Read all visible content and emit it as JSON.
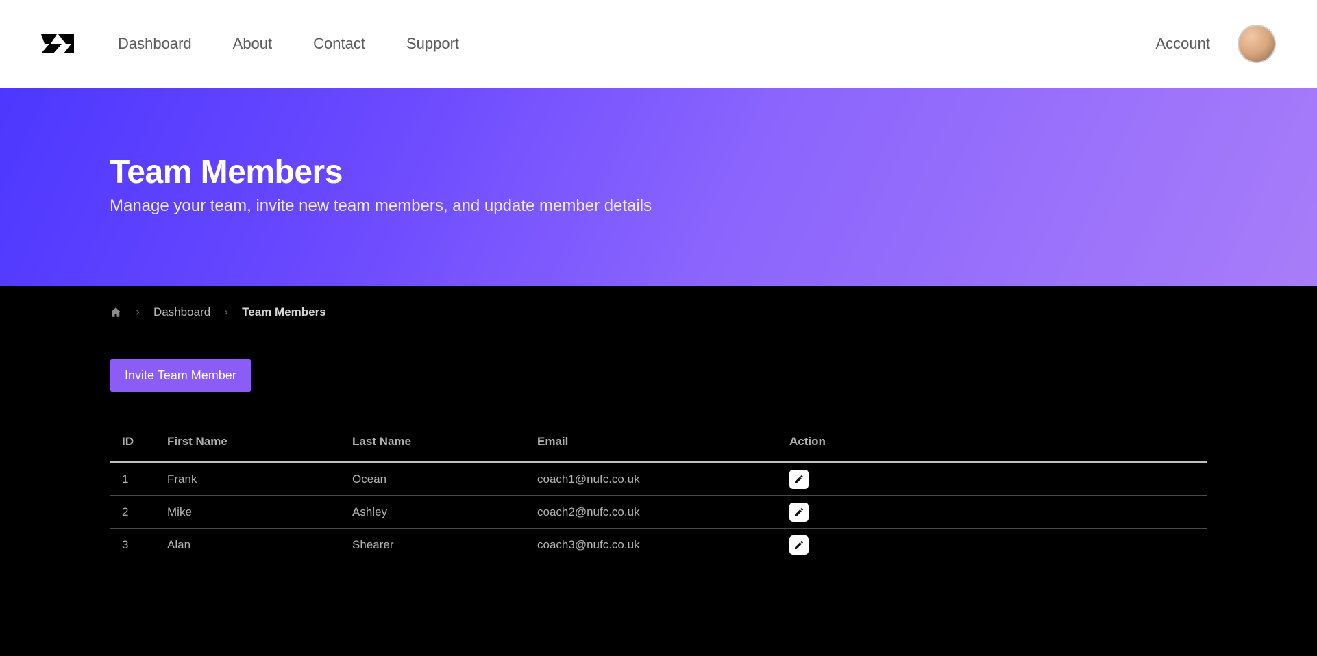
{
  "nav": {
    "links": [
      "Dashboard",
      "About",
      "Contact",
      "Support"
    ],
    "account_label": "Account"
  },
  "hero": {
    "title": "Team Members",
    "subtitle": "Manage your team, invite new team members, and update member details"
  },
  "breadcrumb": {
    "dashboard": "Dashboard",
    "current": "Team Members"
  },
  "actions": {
    "invite": "Invite Team Member"
  },
  "table": {
    "headers": {
      "id": "ID",
      "first": "First Name",
      "last": "Last Name",
      "email": "Email",
      "action": "Action"
    },
    "rows": [
      {
        "id": "1",
        "first": "Frank",
        "last": "Ocean",
        "email": "coach1@nufc.co.uk"
      },
      {
        "id": "2",
        "first": "Mike",
        "last": "Ashley",
        "email": "coach2@nufc.co.uk"
      },
      {
        "id": "3",
        "first": "Alan",
        "last": "Shearer",
        "email": "coach3@nufc.co.uk"
      }
    ]
  }
}
